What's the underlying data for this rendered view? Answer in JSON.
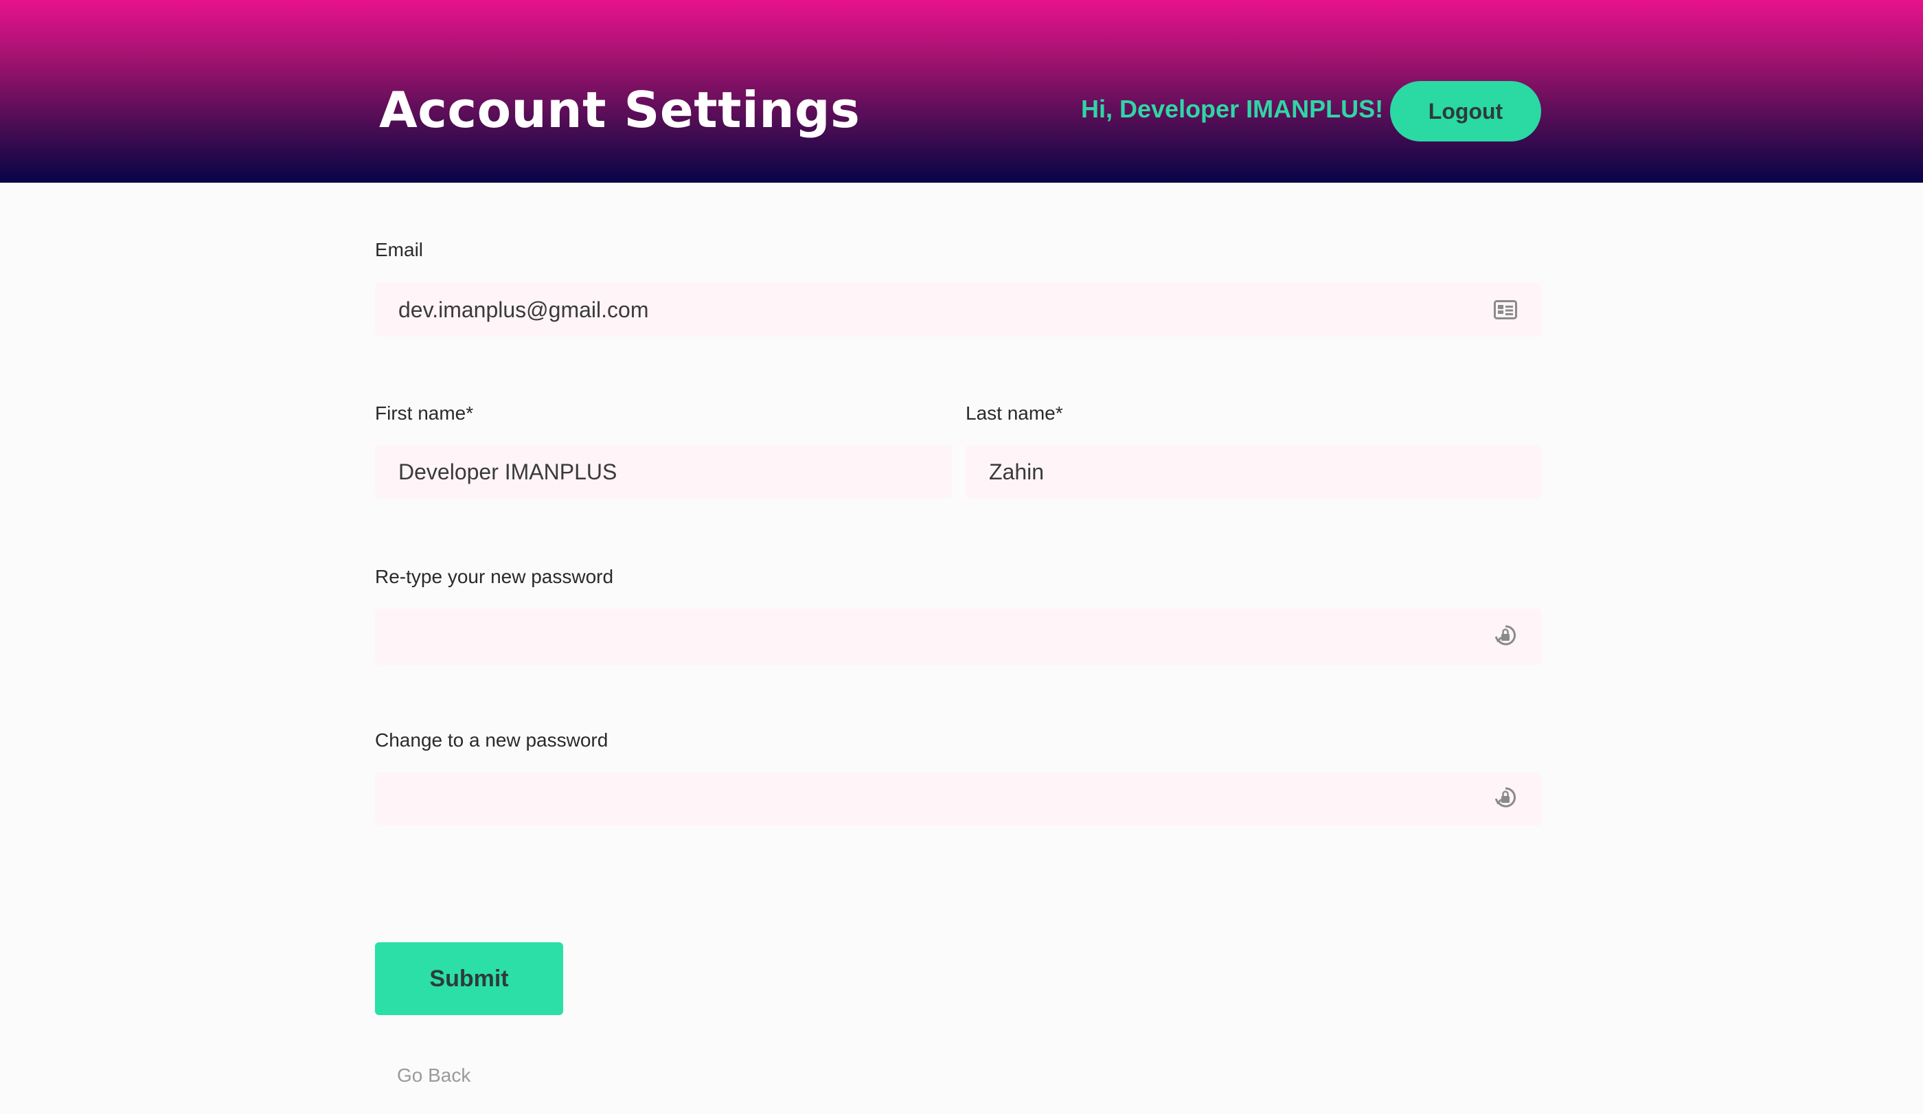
{
  "header": {
    "title": "Account Settings",
    "greeting": "Hi, Developer IMANPLUS!",
    "logout_label": "Logout"
  },
  "form": {
    "email": {
      "label": "Email",
      "value": "dev.imanplus@gmail.com",
      "icon": "id-card-icon"
    },
    "first_name": {
      "label": "First name*",
      "value": "Developer IMANPLUS"
    },
    "last_name": {
      "label": "Last name*",
      "value": "Zahin"
    },
    "retype_password": {
      "label": "Re-type your new password",
      "value": "",
      "icon": "lock-reset-icon"
    },
    "new_password": {
      "label": "Change to a new password",
      "value": "",
      "icon": "lock-reset-icon"
    },
    "submit_label": "Submit",
    "go_back_label": "Go Back"
  },
  "colors": {
    "header_gradient_top": "#e8128e",
    "header_gradient_bottom": "#070447",
    "accent_green": "#2bd9a3",
    "greeting_text": "#2fd6a5",
    "input_background": "#fff4f7",
    "page_background": "#fbfbfb"
  }
}
